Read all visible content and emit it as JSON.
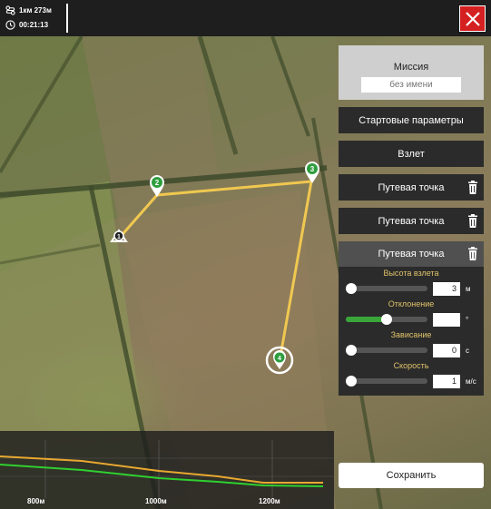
{
  "topbar": {
    "distance": "1км 273м",
    "time": "00:21:13",
    "icons": {
      "route": "route-icon",
      "clock": "clock-icon",
      "close": "close-icon"
    }
  },
  "map": {
    "waypoints": [
      {
        "label": "1",
        "kind": "start"
      },
      {
        "label": "2",
        "kind": "waypoint"
      },
      {
        "label": "3",
        "kind": "waypoint"
      },
      {
        "label": "4",
        "kind": "selected"
      }
    ]
  },
  "panel": {
    "mission_title": "Миссия",
    "mission_name_placeholder": "без имени",
    "start_params": "Стартовые параметры",
    "takeoff": "Взлет",
    "waypoint_label": "Путевая точка",
    "waypoint_items": [
      "Путевая точка",
      "Путевая точка"
    ],
    "editor": {
      "title": "Путевая точка",
      "params": [
        {
          "label": "Высота взлета",
          "value": "3",
          "unit": "м",
          "fraction": 0.0
        },
        {
          "label": "Отклонение",
          "value": "",
          "unit": "°",
          "fraction": 0.5
        },
        {
          "label": "Зависание",
          "value": "0",
          "unit": "с",
          "fraction": 0.0
        },
        {
          "label": "Скорость",
          "value": "1",
          "unit": "м/с",
          "fraction": 0.0
        }
      ]
    }
  },
  "save_label": "Сохранить",
  "profile": {
    "ticks": [
      "800м",
      "1000м",
      "1200м"
    ]
  },
  "colors": {
    "route": "#f0c850",
    "waypoint_marker": "#2e9e3e",
    "close": "#d42020",
    "terrain_line": "#2fd02f",
    "altitude_line": "#e8a830"
  }
}
